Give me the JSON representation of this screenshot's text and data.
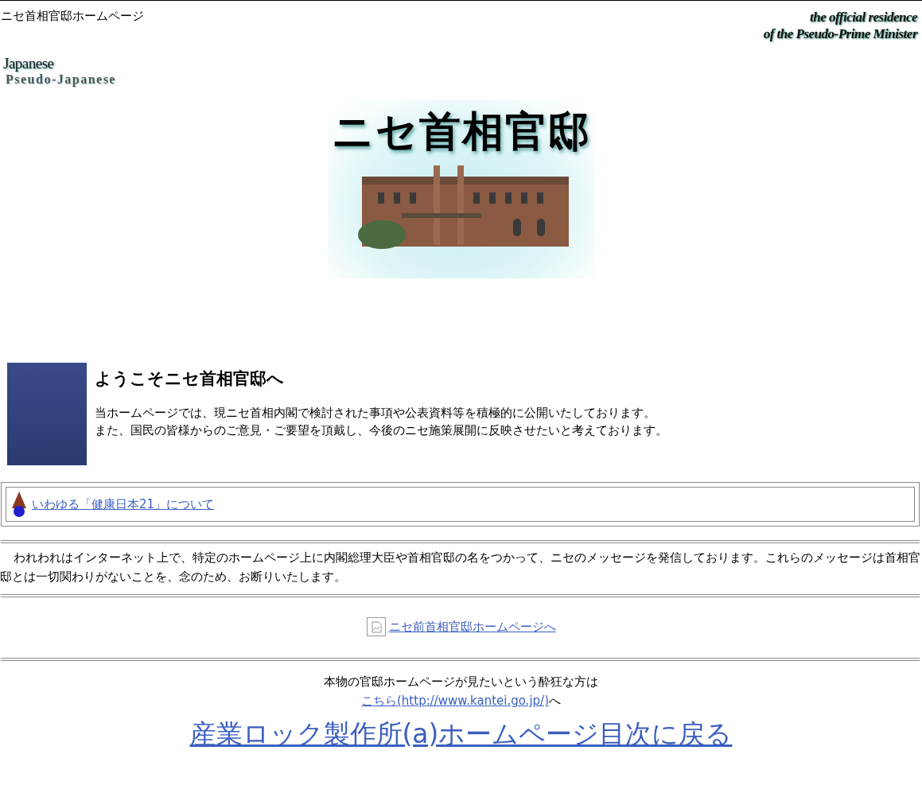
{
  "header": {
    "title": "ニセ首相官邸ホームページ",
    "logo_lines": [
      "the official residence",
      "of the Pseudo-Prime Minister"
    ]
  },
  "languages": [
    {
      "label": "Japanese"
    },
    {
      "label": "Pseudo-Japanese"
    }
  ],
  "banner": {
    "title": "ニセ首相官邸"
  },
  "welcome": {
    "heading": "ようこそニセ首相官邸へ",
    "paragraphs": [
      "当ホームページでは、現ニセ首相内閣で検討された事項や公表資料等を積極的に公開いたしております。",
      "また、国民の皆様からのご意見・ご要望を頂戴し、今後のニセ施策展開に反映させたいと考えております。"
    ]
  },
  "feature_link": "いわゆる「健康日本21」について",
  "notice": "われわれはインターネット上で、特定のホームページ上に内閣総理大臣や首相官邸の名をつかって、ニセのメッセージを発信しております。これらのメッセージは首相官邸とは一切関わりがないことを、念のため、お断りいたします。",
  "previous_link": "ニセ前首相官邸ホームページへ",
  "real_site": {
    "text": "本物の官邸ホームページが見たいという酔狂な方は",
    "link": "こちら(http://www.kantei.go.jp/)",
    "suffix": "へ"
  },
  "back_link": "産業ロック製作所(a)ホームページ目次に戻る"
}
